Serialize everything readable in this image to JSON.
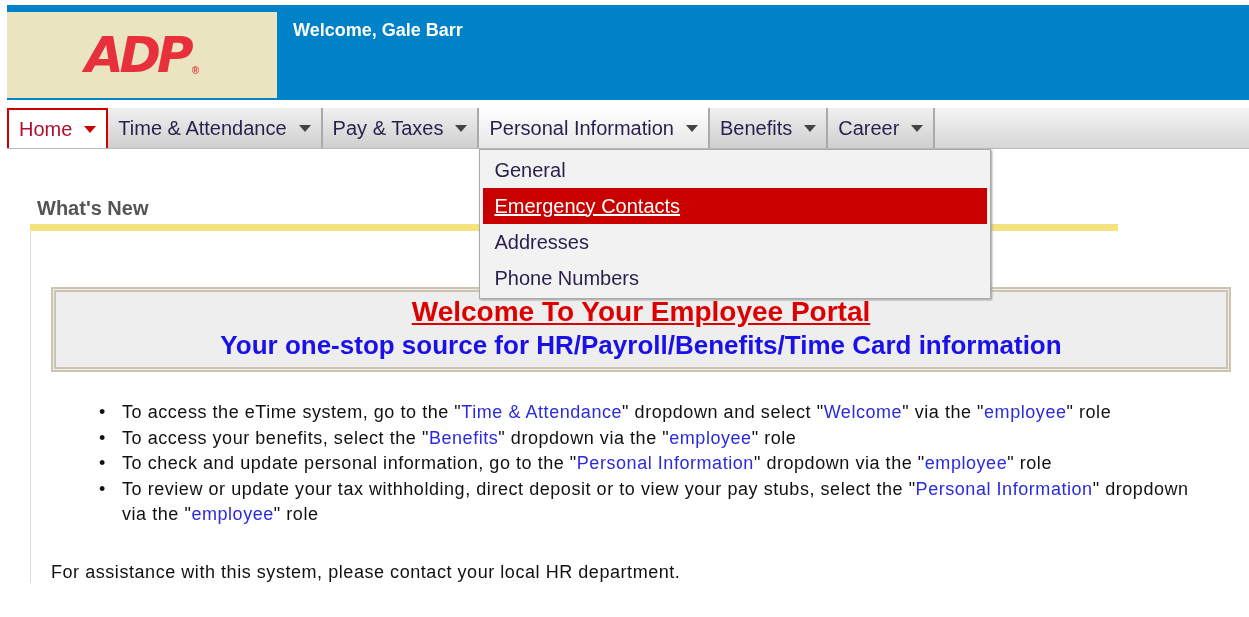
{
  "header": {
    "logo": "ADP",
    "logo_mark": "®",
    "welcome": "Welcome, Gale Barr"
  },
  "tabs": [
    {
      "label": "Home",
      "selected": true,
      "expanded": false
    },
    {
      "label": "Time & Attendance",
      "selected": false,
      "expanded": false
    },
    {
      "label": "Pay & Taxes",
      "selected": false,
      "expanded": false
    },
    {
      "label": "Personal Information",
      "selected": false,
      "expanded": true,
      "menu": [
        {
          "label": "General",
          "selected": false
        },
        {
          "label": "Emergency Contacts",
          "selected": true
        },
        {
          "label": "Addresses",
          "selected": false
        },
        {
          "label": "Phone Numbers",
          "selected": false
        }
      ]
    },
    {
      "label": "Benefits",
      "selected": false,
      "expanded": false
    },
    {
      "label": "Career",
      "selected": false,
      "expanded": false
    }
  ],
  "section_title": "What's New",
  "banner": {
    "title": "Welcome To Your Employee Portal",
    "subtitle": "Your one-stop source for HR/Payroll/Benefits/Time Card information"
  },
  "bullet_marker": "•",
  "bullets": [
    [
      {
        "kind": "plain",
        "text": "To access the eTime system, go to the \""
      },
      {
        "kind": "highlight",
        "text": "Time & Attendance"
      },
      {
        "kind": "plain",
        "text": "\" dropdown and select \""
      },
      {
        "kind": "highlight",
        "text": "Welcome"
      },
      {
        "kind": "plain",
        "text": "\" via the \""
      },
      {
        "kind": "highlight",
        "text": "employee"
      },
      {
        "kind": "plain",
        "text": "\" role"
      }
    ],
    [
      {
        "kind": "plain",
        "text": "To access your benefits, select the \""
      },
      {
        "kind": "highlight",
        "text": "Benefits"
      },
      {
        "kind": "plain",
        "text": "\" dropdown via the \""
      },
      {
        "kind": "highlight",
        "text": "employee"
      },
      {
        "kind": "plain",
        "text": "\" role"
      }
    ],
    [
      {
        "kind": "plain",
        "text": "To check and update personal information, go to the \""
      },
      {
        "kind": "highlight",
        "text": "Personal Information"
      },
      {
        "kind": "plain",
        "text": "\" dropdown via the \""
      },
      {
        "kind": "highlight",
        "text": "employee"
      },
      {
        "kind": "plain",
        "text": "\" role"
      }
    ],
    [
      {
        "kind": "plain",
        "text": "To review or update your tax withholding, direct deposit or to view your pay stubs, select the \""
      },
      {
        "kind": "highlight",
        "text": "Personal Information"
      },
      {
        "kind": "plain",
        "text": "\" dropdown via the \""
      },
      {
        "kind": "highlight",
        "text": "employee"
      },
      {
        "kind": "plain",
        "text": "\" role"
      }
    ]
  ],
  "footer": "For assistance with this system, please contact your local HR department."
}
